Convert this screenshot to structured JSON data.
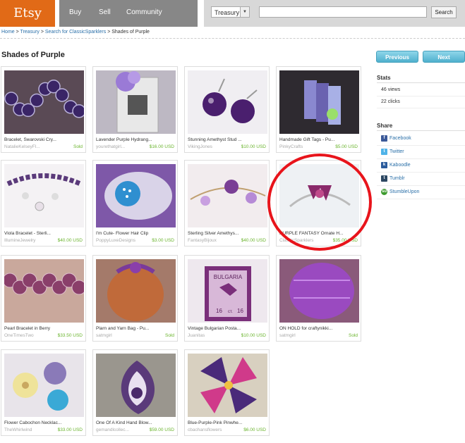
{
  "header": {
    "logo": "Etsy",
    "nav": {
      "buy": "Buy",
      "sell": "Sell",
      "community": "Community"
    },
    "search": {
      "scope": "Treasury",
      "button": "Search",
      "query": ""
    }
  },
  "breadcrumb": {
    "home": "Home",
    "treasury": "Treasury",
    "search": "Search for ClassicSparklers",
    "current": "Shades of Purple",
    "sep": " > "
  },
  "page_title": "Shades of Purple",
  "pager": {
    "previous": "Previous",
    "next": "Next"
  },
  "sidebar": {
    "stats_title": "Stats",
    "views": "46 views",
    "clicks": "22 clicks",
    "share_title": "Share",
    "share": [
      {
        "label": "Facebook",
        "icon": "facebook-icon",
        "color": "#3b5998",
        "glyph": "f"
      },
      {
        "label": "Twitter",
        "icon": "twitter-icon",
        "color": "#4fb3e8",
        "glyph": "t"
      },
      {
        "label": "Kaboodle",
        "icon": "kaboodle-icon",
        "color": "#2a5b9c",
        "glyph": "k"
      },
      {
        "label": "Tumblr",
        "icon": "tumblr-icon",
        "color": "#2c4762",
        "glyph": "t"
      },
      {
        "label": "StumbleUpon",
        "icon": "stumbleupon-icon",
        "color": "#3c9a2d",
        "glyph": "su"
      }
    ]
  },
  "items": [
    {
      "title": "Bracelet, Swarovski Cry...",
      "seller": "NatalieKelseyFl...",
      "price": "Sold",
      "bg": "#5a4a55",
      "accent": "#3a2566"
    },
    {
      "title": "Lavender Purple Hydrang...",
      "seller": "yourethatgirl...",
      "price": "$16.00 USD",
      "bg": "#bdb8c3",
      "accent": "#9a7ad6"
    },
    {
      "title": "Stunning Amethyst Stud ...",
      "seller": "VikingJones",
      "price": "$10.00 USD",
      "bg": "#f0eef2",
      "accent": "#4a1f6e"
    },
    {
      "title": "Handmade Gift Tags - Pu...",
      "seller": "PinkyCrafts",
      "price": "$5.00 USD",
      "bg": "#2e2a30",
      "accent": "#6a62b0"
    },
    {
      "title": "Viola Bracelet - Sterli...",
      "seller": "IllumineJewelry",
      "price": "$40.00 USD",
      "bg": "#f4f2f4",
      "accent": "#5a3a7a"
    },
    {
      "title": "I'm Cute- Flower Hair Clip",
      "seller": "PoppyLuxeDesigns",
      "price": "$3.00 USD",
      "bg": "#7e58a8",
      "accent": "#2f8fd0"
    },
    {
      "title": "Sterling Silver Amethys...",
      "seller": "FantasyBijoux",
      "price": "$40.00 USD",
      "bg": "#f2ecee",
      "accent": "#7a3f95"
    },
    {
      "title": "PURPLE FANTASY Ornate H...",
      "seller": "ClassicSparklers",
      "price": "$35.00 USD",
      "bg": "#eef1f4",
      "accent": "#8a2a6a"
    },
    {
      "title": "Pearl Bracelet in Berry",
      "seller": "OneTimesTwo",
      "price": "$33.50 USD",
      "bg": "#c9a89c",
      "accent": "#8a3f6a"
    },
    {
      "title": "Plarn and Yarn Bag - Pu...",
      "seller": "satmgirl",
      "price": "Sold",
      "bg": "#a47a6a",
      "accent": "#c06a3a"
    },
    {
      "title": "Vintage Bulgarian Posta...",
      "seller": "Juanitas",
      "price": "$10.00 USD",
      "bg": "#eee8ee",
      "accent": "#7a2f7a"
    },
    {
      "title": "ON HOLD for craftynikki...",
      "seller": "satmgirl",
      "price": "Sold",
      "bg": "#8a5a7a",
      "accent": "#9a4ac0"
    },
    {
      "title": "Flower Cabochon Necklac...",
      "seller": "TheWhirlwind",
      "price": "$33.00 USD",
      "bg": "#e8e4ea",
      "accent": "#8a7ab8"
    },
    {
      "title": "One Of A Kind Hand Blow...",
      "seller": "gemandlcollec...",
      "price": "$59.00 USD",
      "bg": "#9a968e",
      "accent": "#5a3a7a"
    },
    {
      "title": "Blue-Purple-Pink Pinwhe...",
      "seller": "cbachansflowers",
      "price": "$6.00 USD",
      "bg": "#d8d0c0",
      "accent": "#4a2a7a"
    }
  ],
  "stamp": {
    "country": "BULGARIA",
    "value": "16",
    "unit": "ст."
  }
}
